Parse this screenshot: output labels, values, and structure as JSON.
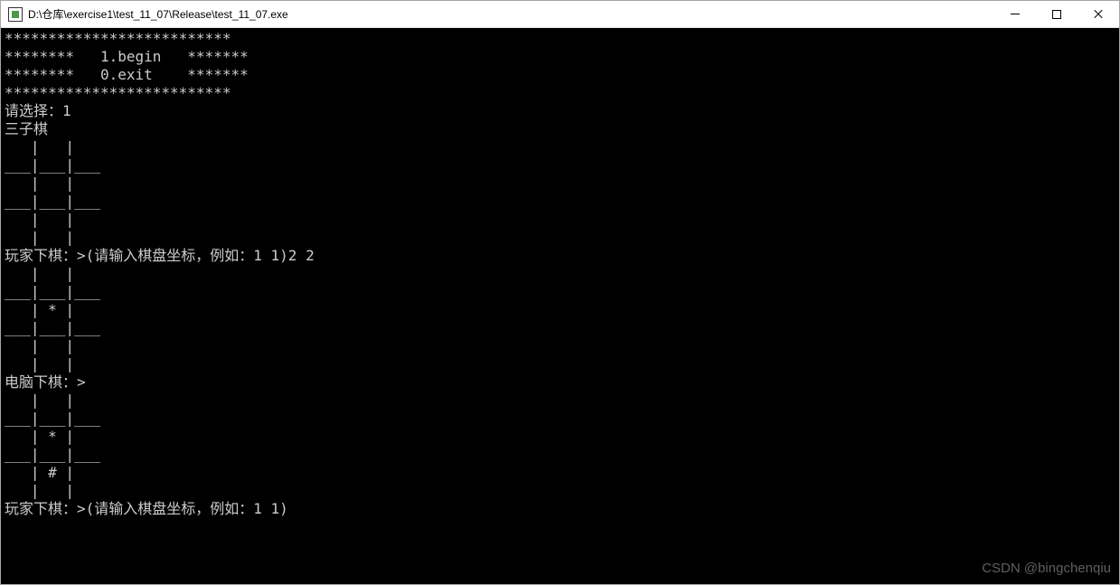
{
  "titlebar": {
    "title": "D:\\仓库\\exercise1\\test_11_07\\Release\\test_11_07.exe"
  },
  "console": {
    "lines": [
      "**************************",
      "********   1.begin   *******",
      "********   0.exit    *******",
      "**************************",
      "请选择：1",
      "三子棋",
      "   |   |   ",
      "___|___|___",
      "   |   |   ",
      "___|___|___",
      "   |   |   ",
      "   |   |   ",
      "玩家下棋：>(请输入棋盘坐标，例如：1 1)2 2",
      "   |   |   ",
      "___|___|___",
      "   | * |   ",
      "___|___|___",
      "   |   |   ",
      "   |   |   ",
      "电脑下棋：>",
      "   |   |   ",
      "___|___|___",
      "   | * |   ",
      "___|___|___",
      "   | # |   ",
      "   |   |   ",
      "玩家下棋：>(请输入棋盘坐标，例如：1 1)"
    ]
  },
  "watermark": "CSDN @bingchenqiu"
}
